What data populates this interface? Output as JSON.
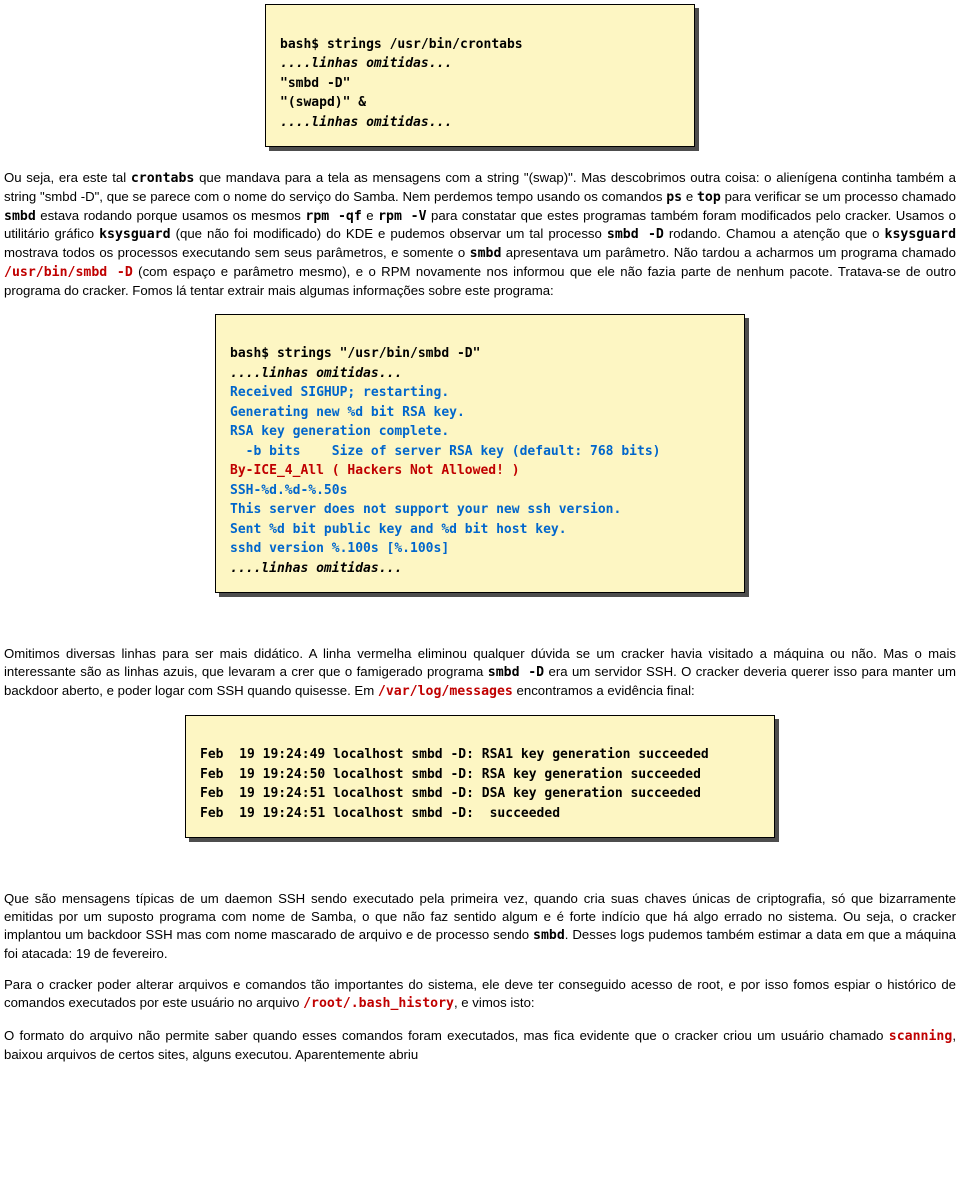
{
  "box1": {
    "l1": "bash$ strings /usr/bin/crontabs",
    "l2": "....linhas omitidas...",
    "l3": "\"smbd -D\"",
    "l4": "\"(swapd)\" &",
    "l5": "....linhas omitidas..."
  },
  "para1_a": "Ou seja, era este tal ",
  "para1_b": "crontabs",
  "para1_c": " que mandava para a tela as mensagens com a string \"(swap)\". Mas descobrimos outra coisa: o alienígena continha também a string \"smbd -D\", que se parece com o nome do serviço do Samba. Nem perdemos tempo usando os comandos ",
  "para1_d": "ps",
  "para1_e": " e ",
  "para1_f": "top",
  "para1_g": " para verificar se um processo chamado ",
  "para1_h": "smbd",
  "para1_i": " estava rodando porque usamos os mesmos ",
  "para1_j": "rpm -qf",
  "para1_k": " e ",
  "para1_l": "rpm -V",
  "para1_m": " para constatar que estes programas também foram modificados pelo cracker. Usamos o utilitário gráfico ",
  "para1_n": "ksysguard",
  "para1_o": " (que não foi modificado) do KDE e pudemos observar um tal processo ",
  "para1_p": "smbd -D",
  "para1_q": " rodando. Chamou a atenção que o ",
  "para1_r": "ksysguard",
  "para1_s": " mostrava todos os processos executando sem seus parâmetros, e somente o ",
  "para1_t": "smbd",
  "para1_u": " apresentava um parâmetro. Não tardou a acharmos um programa chamado ",
  "para1_v": "/usr/bin/smbd -D",
  "para1_w": " (com espaço e parâmetro mesmo), e o RPM novamente nos informou que ele não fazia parte de nenhum pacote. Tratava-se de outro programa do cracker. Fomos lá tentar extrair mais algumas informações sobre este programa:",
  "box2": {
    "l1": "bash$ strings \"/usr/bin/smbd -D\"",
    "l2": "....linhas omitidas...",
    "l3": "Received SIGHUP; restarting.",
    "l4": "Generating new %d bit RSA key.",
    "l5": "RSA key generation complete.",
    "l6": "  -b bits    Size of server RSA key (default: 768 bits)",
    "l7": "By-ICE_4_All ( Hackers Not Allowed! )",
    "l8": "SSH-%d.%d-%.50s",
    "l9": "This server does not support your new ssh version.",
    "l10": "Sent %d bit public key and %d bit host key.",
    "l11": "sshd version %.100s [%.100s]",
    "l12": "....linhas omitidas..."
  },
  "para2_a": "Omitimos diversas linhas para ser mais didático. A linha vermelha eliminou qualquer dúvida se um cracker havia visitado a máquina ou não. Mas o mais interessante são as linhas azuis, que levaram a crer que o famigerado programa ",
  "para2_b": "smbd -D",
  "para2_c": " era um servidor SSH. O cracker deveria querer isso para manter um backdoor aberto, e poder logar com SSH quando quisesse. Em ",
  "para2_d": "/var/log/messages",
  "para2_e": " encontramos a evidência final:",
  "box3": {
    "l1": "Feb  19 19:24:49 localhost smbd -D: RSA1 key generation succeeded",
    "l2": "Feb  19 19:24:50 localhost smbd -D: RSA key generation succeeded",
    "l3": "Feb  19 19:24:51 localhost smbd -D: DSA key generation succeeded",
    "l4": "Feb  19 19:24:51 localhost smbd -D:  succeeded"
  },
  "para3_a": "Que são mensagens típicas de um daemon SSH sendo executado pela primeira vez, quando cria suas chaves únicas de criptografia, só que bizarramente emitidas por um suposto programa com nome de Samba, o que não faz sentido algum e é forte indício que há algo errado no sistema. Ou seja, o cracker implantou um backdoor SSH mas com nome mascarado de arquivo e de processo sendo ",
  "para3_b": "smbd",
  "para3_c": ". Desses logs pudemos também estimar a data em que a máquina foi atacada: 19 de fevereiro.",
  "para4_a": "Para o cracker poder alterar arquivos e comandos tão importantes do sistema, ele deve ter conseguido acesso de root, e por isso fomos espiar o histórico de comandos executados por este usuário no arquivo ",
  "para4_b": "/root/.bash_history",
  "para4_c": ", e vimos isto:",
  "para5_a": "O formato do arquivo não permite saber quando esses comandos foram executados, mas fica evidente que o cracker criou um usuário chamado ",
  "para5_b": "scanning",
  "para5_c": ", baixou arquivos de certos sites, alguns executou. Aparentemente abriu"
}
